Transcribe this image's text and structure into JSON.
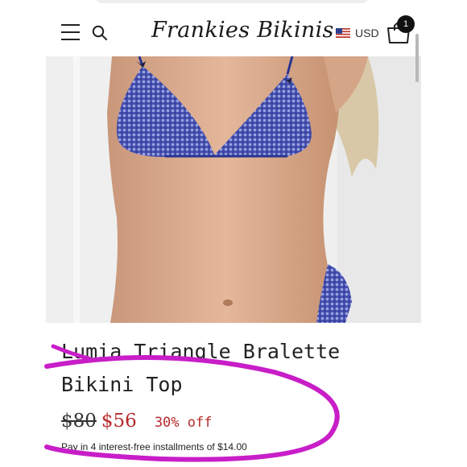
{
  "header": {
    "logo": "Frankies Bikinis",
    "currency": "USD",
    "cart_count": "1"
  },
  "product": {
    "title_line1": "Lumia Triangle Bralette",
    "title_line2": "Bikini Top",
    "old_price": "$80",
    "sale_price": "$56",
    "discount": "30% off",
    "installments": "Pay in 4 interest-free installments of $14.00"
  },
  "colors": {
    "accent_sale": "#b52a2a",
    "marker": "#c81ec8",
    "swimsuit": "#4a55b4"
  },
  "icons": [
    "hamburger-menu-icon",
    "search-icon",
    "us-flag-icon",
    "cart-icon"
  ]
}
